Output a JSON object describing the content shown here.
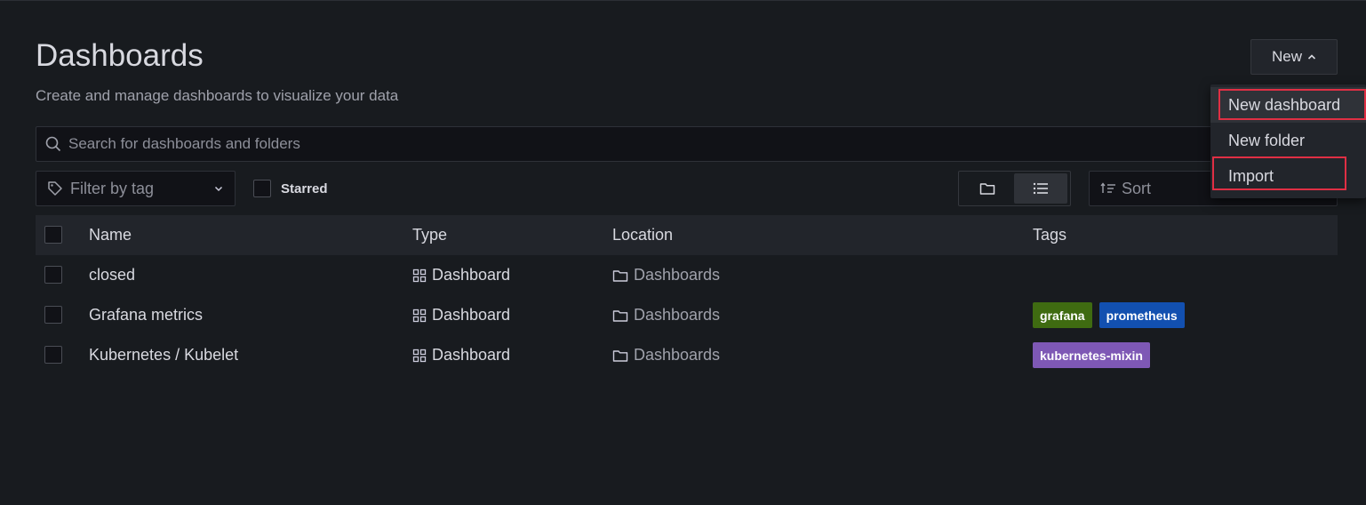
{
  "header": {
    "title": "Dashboards",
    "subtitle": "Create and manage dashboards to visualize your data",
    "new_button_label": "New"
  },
  "new_menu": {
    "items": [
      {
        "label": "New dashboard"
      },
      {
        "label": "New folder"
      },
      {
        "label": "Import"
      }
    ]
  },
  "search": {
    "placeholder": "Search for dashboards and folders",
    "value": ""
  },
  "filters": {
    "tag_filter_placeholder": "Filter by tag",
    "starred_label": "Starred",
    "starred_checked": false,
    "view_mode": "list",
    "sort_placeholder": "Sort"
  },
  "table": {
    "columns": [
      "Name",
      "Type",
      "Location",
      "Tags"
    ],
    "rows": [
      {
        "name": "closed",
        "type": "Dashboard",
        "location": "Dashboards",
        "tags": []
      },
      {
        "name": "Grafana metrics",
        "type": "Dashboard",
        "location": "Dashboards",
        "tags": [
          {
            "label": "grafana",
            "color": "#3f6b11"
          },
          {
            "label": "prometheus",
            "color": "#1250b0"
          }
        ]
      },
      {
        "name": "Kubernetes / Kubelet",
        "type": "Dashboard",
        "location": "Dashboards",
        "tags": [
          {
            "label": "kubernetes-mixin",
            "color": "#7e58b5"
          }
        ]
      }
    ]
  },
  "colors": {
    "background": "#181b1f",
    "panel": "#22252b",
    "highlight": "#e02f44"
  }
}
